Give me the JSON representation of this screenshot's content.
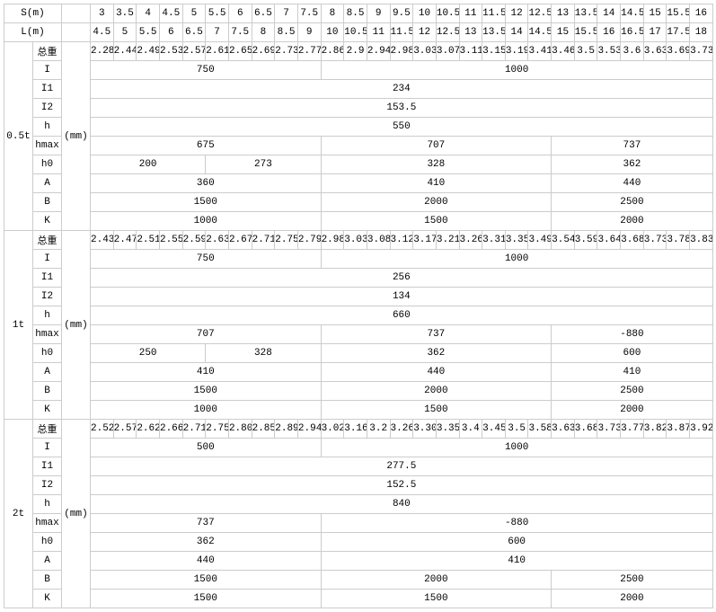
{
  "header": {
    "s_label": "S(m)",
    "l_label": "L(m)",
    "s_values": [
      "3",
      "3.5",
      "4",
      "4.5",
      "5",
      "5.5",
      "6",
      "6.5",
      "7",
      "7.5",
      "8",
      "8.5",
      "9",
      "9.5",
      "10",
      "10.5",
      "11",
      "11.5",
      "12",
      "12.5",
      "13",
      "13.5",
      "14",
      "14.5",
      "15",
      "15.5",
      "16"
    ],
    "l_values": [
      "4.5",
      "5",
      "5.5",
      "6",
      "6.5",
      "7",
      "7.5",
      "8",
      "8.5",
      "9",
      "10",
      "10.5",
      "11",
      "11.5",
      "12",
      "12.5",
      "13",
      "13.5",
      "14",
      "14.5",
      "15",
      "15.5",
      "16",
      "16.5",
      "17",
      "17.5",
      "18"
    ]
  },
  "unit": "(mm)",
  "groups": [
    {
      "name": "0.5t",
      "weight_label": "总重",
      "weight_values": [
        "2.284",
        "2.44",
        "2.49",
        "2.53",
        "2.57",
        "2.61",
        "2.65",
        "2.69",
        "2.73",
        "2.77",
        "2.86",
        "2.9",
        "2.94",
        "2.98",
        "3.03",
        "3.07",
        "3.11",
        "3.15",
        "3.19",
        "3.41",
        "3.46",
        "3.5",
        "3.53",
        "3.6",
        "3.63",
        "3.69",
        "3.73"
      ],
      "rows": [
        {
          "label": "I",
          "spans": [
            {
              "colspan": 10,
              "value": "750"
            },
            {
              "colspan": 17,
              "value": "1000"
            }
          ]
        },
        {
          "label": "I1",
          "spans": [
            {
              "colspan": 27,
              "value": "234"
            }
          ]
        },
        {
          "label": "I2",
          "spans": [
            {
              "colspan": 27,
              "value": "153.5"
            }
          ]
        },
        {
          "label": "h",
          "spans": [
            {
              "colspan": 27,
              "value": "550"
            }
          ]
        },
        {
          "label": "hmax",
          "spans": [
            {
              "colspan": 10,
              "value": "675"
            },
            {
              "colspan": 10,
              "value": "707"
            },
            {
              "colspan": 7,
              "value": "737"
            }
          ]
        },
        {
          "label": "h0",
          "spans": [
            {
              "colspan": 5,
              "value": "200"
            },
            {
              "colspan": 5,
              "value": "273"
            },
            {
              "colspan": 10,
              "value": "328"
            },
            {
              "colspan": 7,
              "value": "362"
            }
          ]
        },
        {
          "label": "A",
          "spans": [
            {
              "colspan": 10,
              "value": "360"
            },
            {
              "colspan": 10,
              "value": "410"
            },
            {
              "colspan": 7,
              "value": "440"
            }
          ]
        },
        {
          "label": "B",
          "spans": [
            {
              "colspan": 10,
              "value": "1500"
            },
            {
              "colspan": 10,
              "value": "2000"
            },
            {
              "colspan": 7,
              "value": "2500"
            }
          ]
        },
        {
          "label": "K",
          "spans": [
            {
              "colspan": 10,
              "value": "1000"
            },
            {
              "colspan": 10,
              "value": "1500"
            },
            {
              "colspan": 7,
              "value": "2000"
            }
          ]
        }
      ]
    },
    {
      "name": "1t",
      "weight_label": "总重",
      "weight_values": [
        "2.43",
        "2.47",
        "2.51",
        "2.55",
        "2.59",
        "2.63",
        "2.67",
        "2.71",
        "2.75",
        "2.79",
        "2.98",
        "3.03",
        "3.08",
        "3.12",
        "3.17",
        "3.21",
        "3.26",
        "3.31",
        "3.35",
        "3.49",
        "3.54",
        "3.59",
        "3.64",
        "3.68",
        "3.73",
        "3.78",
        "3.83"
      ],
      "rows": [
        {
          "label": "I",
          "spans": [
            {
              "colspan": 10,
              "value": "750"
            },
            {
              "colspan": 17,
              "value": "1000"
            }
          ]
        },
        {
          "label": "I1",
          "spans": [
            {
              "colspan": 27,
              "value": "256"
            }
          ]
        },
        {
          "label": "I2",
          "spans": [
            {
              "colspan": 27,
              "value": "134"
            }
          ]
        },
        {
          "label": "h",
          "spans": [
            {
              "colspan": 27,
              "value": "660"
            }
          ]
        },
        {
          "label": "hmax",
          "spans": [
            {
              "colspan": 10,
              "value": "707"
            },
            {
              "colspan": 10,
              "value": "737"
            },
            {
              "colspan": 7,
              "value": "-880"
            }
          ]
        },
        {
          "label": "h0",
          "spans": [
            {
              "colspan": 5,
              "value": "250"
            },
            {
              "colspan": 5,
              "value": "328"
            },
            {
              "colspan": 10,
              "value": "362"
            },
            {
              "colspan": 7,
              "value": "600"
            }
          ]
        },
        {
          "label": "A",
          "spans": [
            {
              "colspan": 10,
              "value": "410"
            },
            {
              "colspan": 10,
              "value": "440"
            },
            {
              "colspan": 7,
              "value": "410"
            }
          ]
        },
        {
          "label": "B",
          "spans": [
            {
              "colspan": 10,
              "value": "1500"
            },
            {
              "colspan": 10,
              "value": "2000"
            },
            {
              "colspan": 7,
              "value": "2500"
            }
          ]
        },
        {
          "label": "K",
          "spans": [
            {
              "colspan": 10,
              "value": "1000"
            },
            {
              "colspan": 10,
              "value": "1500"
            },
            {
              "colspan": 7,
              "value": "2000"
            }
          ]
        }
      ]
    },
    {
      "name": "2t",
      "weight_label": "总重",
      "weight_values": [
        "2.52",
        "2.57",
        "2.62",
        "2.66",
        "2.71",
        "2.75",
        "2.80",
        "2.85",
        "2.89",
        "2.94",
        "3.02",
        "3.16",
        "3.2",
        "3.26",
        "3.30",
        "3.35",
        "3.4",
        "3.45",
        "3.5",
        "3.58",
        "3.63",
        "3.68",
        "3.73",
        "3.77",
        "3.82",
        "3.87",
        "3.92"
      ],
      "rows": [
        {
          "label": "I",
          "spans": [
            {
              "colspan": 10,
              "value": "500"
            },
            {
              "colspan": 17,
              "value": "1000"
            }
          ]
        },
        {
          "label": "I1",
          "spans": [
            {
              "colspan": 27,
              "value": "277.5"
            }
          ]
        },
        {
          "label": "I2",
          "spans": [
            {
              "colspan": 27,
              "value": "152.5"
            }
          ]
        },
        {
          "label": "h",
          "spans": [
            {
              "colspan": 27,
              "value": "840"
            }
          ]
        },
        {
          "label": "hmax",
          "spans": [
            {
              "colspan": 10,
              "value": "737"
            },
            {
              "colspan": 17,
              "value": "-880"
            }
          ]
        },
        {
          "label": "h0",
          "spans": [
            {
              "colspan": 10,
              "value": "362"
            },
            {
              "colspan": 17,
              "value": "600"
            }
          ]
        },
        {
          "label": "A",
          "spans": [
            {
              "colspan": 10,
              "value": "440"
            },
            {
              "colspan": 17,
              "value": "410"
            }
          ]
        },
        {
          "label": "B",
          "spans": [
            {
              "colspan": 10,
              "value": "1500"
            },
            {
              "colspan": 10,
              "value": "2000"
            },
            {
              "colspan": 7,
              "value": "2500"
            }
          ]
        },
        {
          "label": "K",
          "spans": [
            {
              "colspan": 10,
              "value": "1500"
            },
            {
              "colspan": 10,
              "value": "1500"
            },
            {
              "colspan": 7,
              "value": "2000"
            }
          ]
        }
      ]
    }
  ]
}
